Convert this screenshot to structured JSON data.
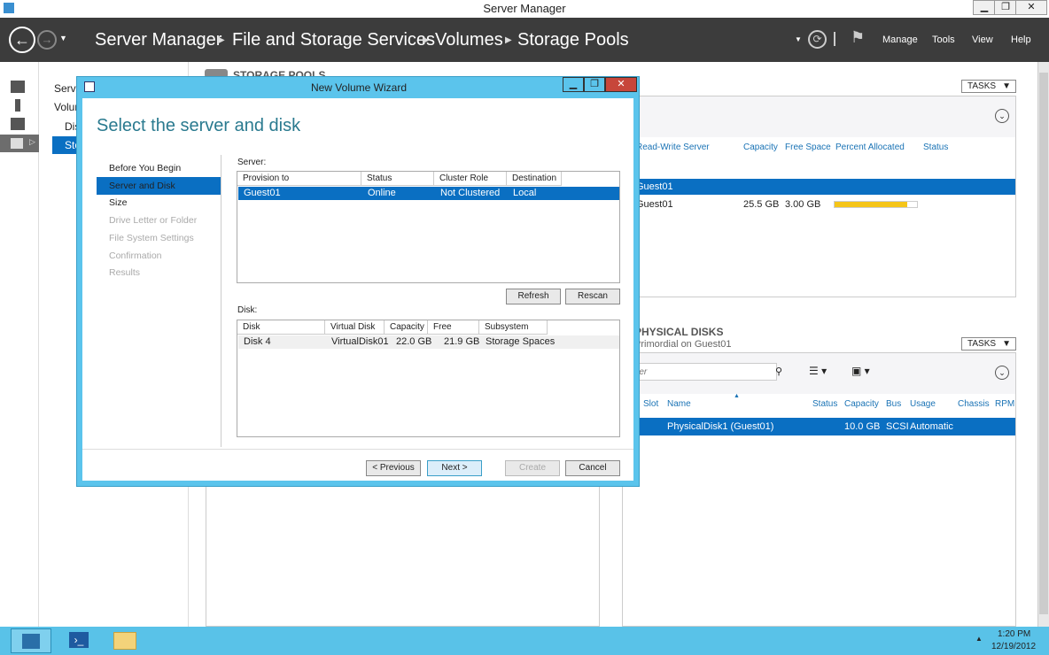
{
  "window": {
    "title": "Server Manager",
    "minimize": "▁",
    "maximize": "❐",
    "close": "✕"
  },
  "nav": {
    "breadcrumb": [
      "Server Manager",
      "File and Storage Services",
      "Volumes",
      "Storage Pools"
    ],
    "menus": [
      "Manage",
      "Tools",
      "View",
      "Help"
    ]
  },
  "navpane": {
    "items": [
      "Servers",
      "Volumes",
      "Disks",
      "Storage Pools"
    ]
  },
  "storage_pools": {
    "title": "STORAGE POOLS",
    "tasks": "TASKS",
    "columns": [
      "Read-Write Server",
      "Capacity",
      "Free Space",
      "Percent Allocated",
      "Status"
    ],
    "rows": [
      {
        "server": "Guest01",
        "selected": true
      },
      {
        "server": "Guest01",
        "capacity": "25.5 GB",
        "free": "3.00 GB",
        "percent_allocated": 88
      }
    ],
    "accent": "#f5c518"
  },
  "physical_disks": {
    "title": "PHYSICAL DISKS",
    "subtitle": "Primordial on Guest01",
    "tasks": "TASKS",
    "filter_placeholder": "Filter",
    "columns": [
      "Slot",
      "Name",
      "Status",
      "Capacity",
      "Bus",
      "Usage",
      "Chassis",
      "RPM"
    ],
    "rows": [
      {
        "name": "PhysicalDisk1 (Guest01)",
        "capacity": "10.0 GB",
        "bus": "SCSI",
        "usage": "Automatic"
      }
    ]
  },
  "wizard": {
    "title": "New Volume Wizard",
    "heading": "Select the server and disk",
    "steps": [
      {
        "label": "Before You Begin",
        "state": "done"
      },
      {
        "label": "Server and Disk",
        "state": "active"
      },
      {
        "label": "Size",
        "state": "enabled"
      },
      {
        "label": "Drive Letter or Folder",
        "state": "disabled"
      },
      {
        "label": "File System Settings",
        "state": "disabled"
      },
      {
        "label": "Confirmation",
        "state": "disabled"
      },
      {
        "label": "Results",
        "state": "disabled"
      }
    ],
    "server_label": "Server:",
    "server_columns": [
      "Provision to",
      "Status",
      "Cluster Role",
      "Destination"
    ],
    "server_rows": [
      [
        "Guest01",
        "Online",
        "Not Clustered",
        "Local"
      ]
    ],
    "refresh": "Refresh",
    "rescan": "Rescan",
    "disk_label": "Disk:",
    "disk_columns": [
      "Disk",
      "Virtual Disk",
      "Capacity",
      "Free Space",
      "Subsystem"
    ],
    "disk_rows": [
      [
        "Disk 4",
        "VirtualDisk01",
        "22.0 GB",
        "21.9 GB",
        "Storage Spaces"
      ]
    ],
    "previous": "< Previous",
    "next": "Next >",
    "create": "Create",
    "cancel": "Cancel"
  },
  "taskbar": {
    "time": "1:20 PM",
    "date": "12/19/2012"
  }
}
